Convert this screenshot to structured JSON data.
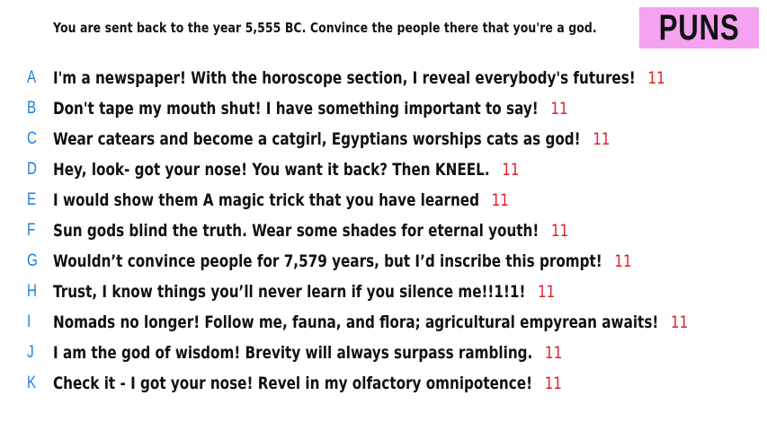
{
  "prompt": "You are sent back to the year 5,555 BC. Convince the people there that you're a god.",
  "badge": {
    "label": "PUNS",
    "color": "#f5a2f0"
  },
  "colors": {
    "letter": "#1f7fd6",
    "score": "#e0202a",
    "text": "#111111"
  },
  "answers": [
    {
      "letter": "A",
      "text": "I'm a newspaper! With the horoscope section, I reveal everybody's futures!",
      "score": "11"
    },
    {
      "letter": "B",
      "text": "Don't tape my mouth shut! I have something important to say!",
      "score": "11"
    },
    {
      "letter": "C",
      "text": "Wear catears and become a catgirl, Egyptians worships cats as god!",
      "score": "11"
    },
    {
      "letter": "D",
      "text": "Hey, look- got your nose! You want it back? Then KNEEL.",
      "score": "11"
    },
    {
      "letter": "E",
      "text": "I would show them A magic trick that you have learned",
      "score": "11"
    },
    {
      "letter": "F",
      "text": "Sun gods blind the truth. Wear some shades for eternal youth!",
      "score": "11"
    },
    {
      "letter": "G",
      "text": "Wouldn’t convince people for 7,579 years, but I’d inscribe this prompt!",
      "score": "11"
    },
    {
      "letter": "H",
      "text": "Trust, I know things you’ll never learn if you silence me!!1!1!",
      "score": "11"
    },
    {
      "letter": "I",
      "text": "Nomads no longer! Follow me, fauna, and flora; agricultural empyrean awaits!",
      "score": "11"
    },
    {
      "letter": "J",
      "text": "I am the god of wisdom! Brevity will always surpass rambling.",
      "score": "11"
    },
    {
      "letter": "K",
      "text": "Check it - I got your nose! Revel in my olfactory omnipotence!",
      "score": "11"
    }
  ]
}
